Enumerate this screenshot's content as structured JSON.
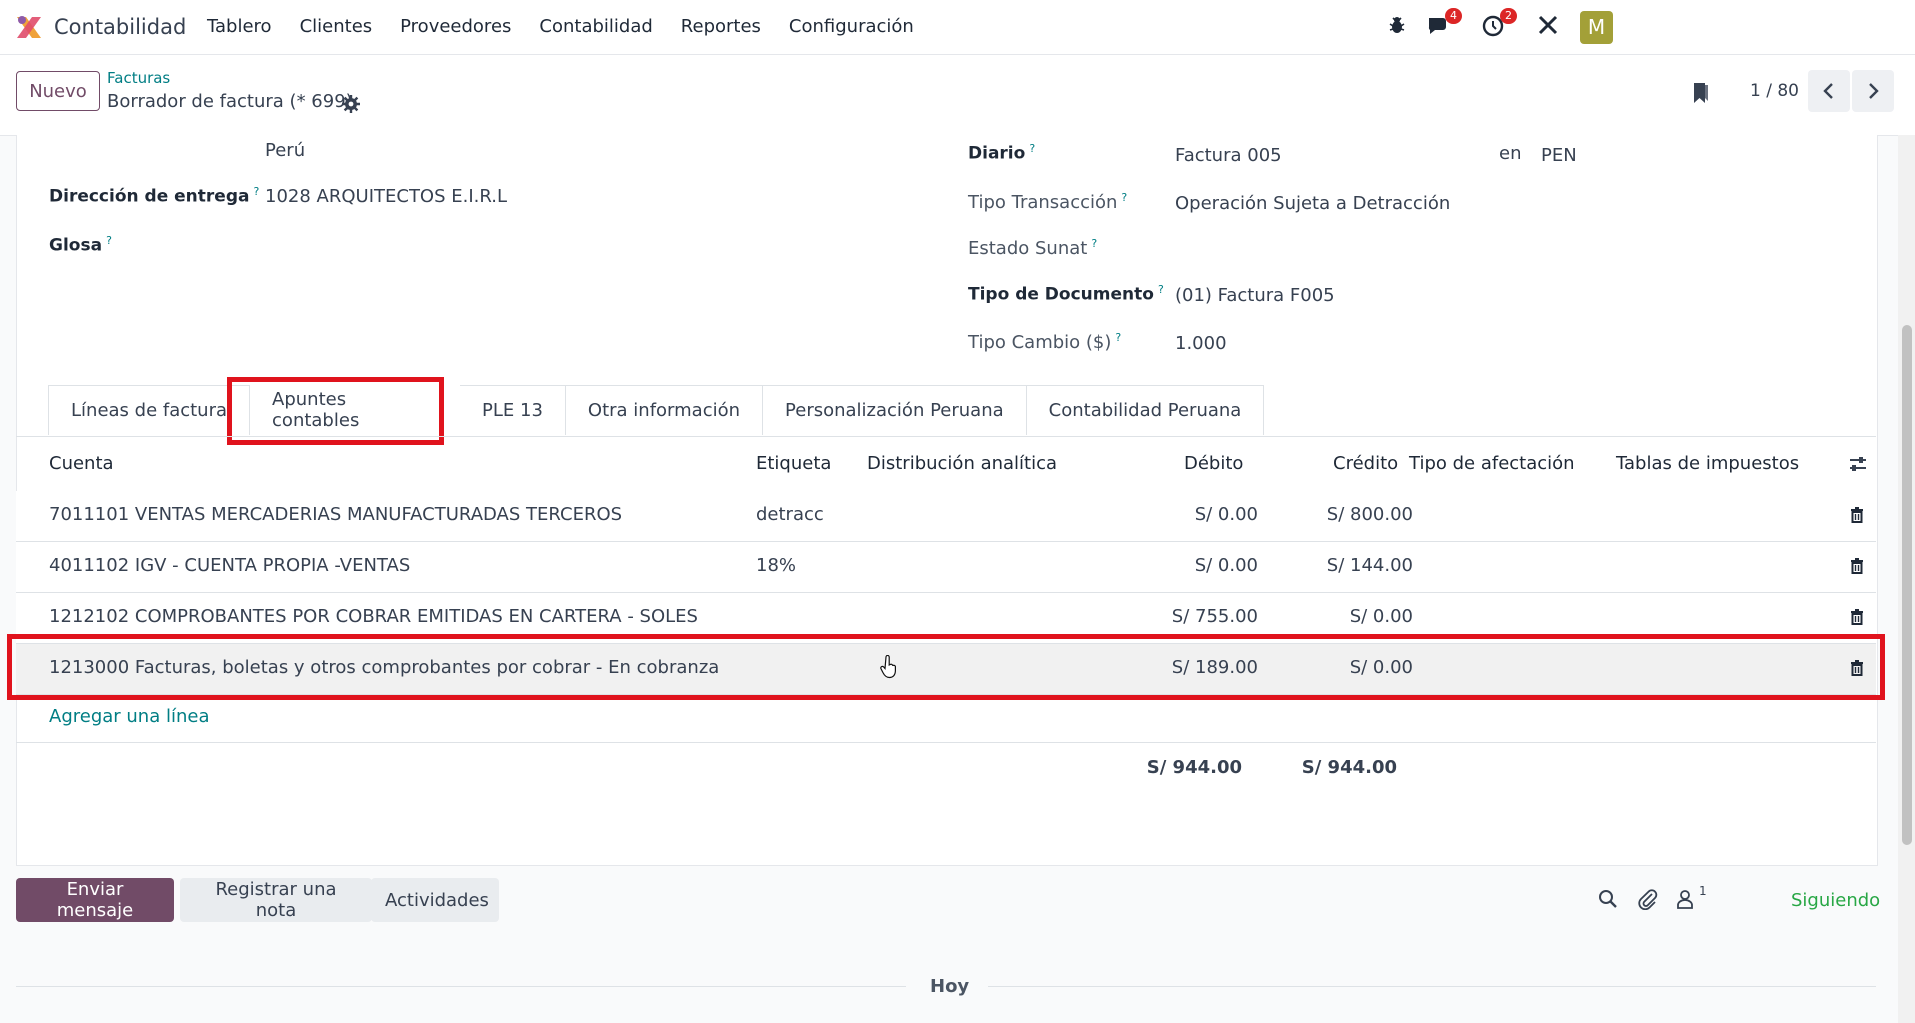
{
  "topbar": {
    "app_name": "Contabilidad",
    "menu": [
      "Tablero",
      "Clientes",
      "Proveedores",
      "Contabilidad",
      "Reportes",
      "Configuración"
    ],
    "messages_badge": "4",
    "activities_badge": "2",
    "avatar_letter": "M",
    "icons": [
      "bug-icon",
      "chat-icon",
      "clock-icon",
      "tools-icon"
    ]
  },
  "subbar": {
    "new_button": "Nuevo",
    "breadcrumb": "Facturas",
    "record_title": "Borrador de factura (* 699)",
    "pager": "1 / 80"
  },
  "form": {
    "country": "Perú",
    "delivery_label": "Dirección de entrega",
    "delivery_value": "1028 ARQUITECTOS E.I.R.L",
    "glosa_label": "Glosa",
    "journal_label": "Diario",
    "journal_value": "Factura 005",
    "currency_in": "en",
    "currency_value": "PEN",
    "transaction_label": "Tipo Transacción",
    "transaction_value": "Operación Sujeta a Detracción",
    "sunat_label": "Estado Sunat",
    "doc_type_label": "Tipo de Documento",
    "doc_type_value": "(01) Factura F005",
    "exchange_label": "Tipo Cambio ($)",
    "exchange_value": "1.000",
    "help_mark": "?"
  },
  "tabs": [
    "Líneas de factura",
    "Apuntes contables",
    "PLE 13",
    "Otra información",
    "Personalización Peruana",
    "Contabilidad Peruana"
  ],
  "table": {
    "headers": {
      "account": "Cuenta",
      "label": "Etiqueta",
      "analytic": "Distribución analítica",
      "debit": "Débito",
      "credit": "Crédito",
      "affectation": "Tipo de afectación",
      "taxes": "Tablas de impuestos"
    },
    "rows": [
      {
        "account": "7011101 VENTAS MERCADERIAS MANUFACTURADAS TERCEROS",
        "label": "detracc",
        "debit": "S/ 0.00",
        "credit": "S/ 800.00"
      },
      {
        "account": "4011102 IGV - CUENTA PROPIA -VENTAS",
        "label": "18%",
        "debit": "S/ 0.00",
        "credit": "S/ 144.00"
      },
      {
        "account": "1212102 COMPROBANTES POR COBRAR EMITIDAS EN CARTERA - SOLES",
        "label": "",
        "debit": "S/ 755.00",
        "credit": "S/ 0.00"
      },
      {
        "account": "1213000 Facturas, boletas y otros comprobantes por cobrar - En cobranza",
        "label": "",
        "debit": "S/ 189.00",
        "credit": "S/ 0.00"
      }
    ],
    "add_line": "Agregar una línea",
    "total_debit": "S/ 944.00",
    "total_credit": "S/ 944.00"
  },
  "chatter": {
    "send_message": "Enviar mensaje",
    "log_note": "Registrar una nota",
    "activities": "Actividades",
    "followers_count": "1",
    "following": "Siguiendo",
    "today": "Hoy"
  },
  "colors": {
    "primary": "#714b67",
    "link": "#017e84",
    "highlight": "#e0131d",
    "badge": "#dc2626",
    "avatar": "#a3a038",
    "following": "#28a745"
  }
}
